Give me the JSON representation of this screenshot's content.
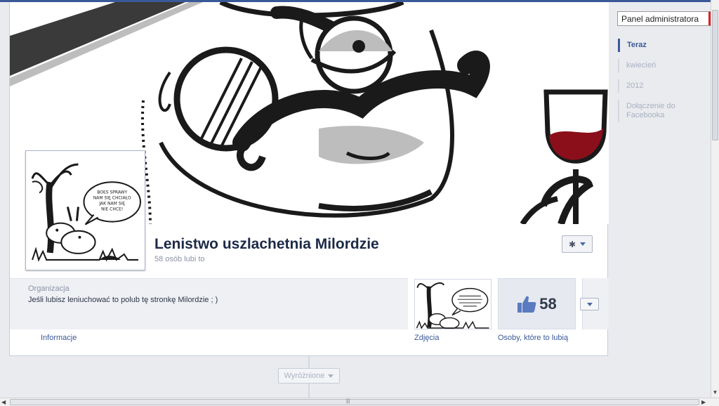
{
  "page": {
    "name": "Lenistwo uszlachetnia Milordzie",
    "likes_line": "58 osób lubi to"
  },
  "about": {
    "category": "Organizacja",
    "description": "Jeśli lubisz leniuchować to polub tę stronkę Milordzie ; )"
  },
  "likes_box": {
    "count": "58"
  },
  "tabs": {
    "info": "Informacje",
    "photos": "Zdjęcia",
    "people": "Osoby, które to lubią"
  },
  "admin_panel": {
    "label": "Panel administratora"
  },
  "timeline_nav": {
    "items": [
      "Teraz",
      "kwiecień",
      "2012",
      "Dołączenie do Facebooka"
    ]
  },
  "featured": {
    "label": "Wyróżnione"
  },
  "comic_text": "BOES SPRAWY NAM SIĘ CHCIAŁO JAK NAM SIĘ NIE CHCE!",
  "colors": {
    "brand": "#3b5998",
    "wine": "#8b0f1a",
    "admin_accent": "#e02020"
  }
}
